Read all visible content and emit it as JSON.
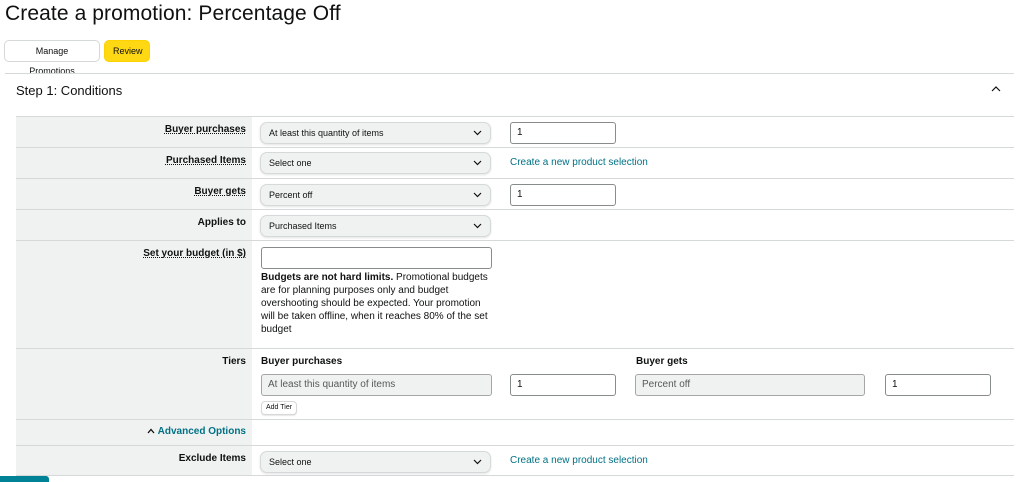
{
  "page": {
    "title": "Create a promotion: Percentage Off",
    "manage_label": "Manage Promotions",
    "review_label": "Review"
  },
  "step1": {
    "title": "Step 1: Conditions",
    "rows": {
      "buyer_purchases": {
        "label": "Buyer purchases",
        "select": "At least this quantity of items",
        "input": "1"
      },
      "purchased_items": {
        "label": "Purchased Items",
        "select": "Select one",
        "link": "Create a new product selection"
      },
      "buyer_gets": {
        "label": "Buyer gets",
        "select": "Percent off",
        "input": "1"
      },
      "applies_to": {
        "label": "Applies to",
        "select": "Purchased Items"
      },
      "budget": {
        "label": "Set your budget (in $)",
        "input": "",
        "note_bold": "Budgets are not hard limits.",
        "note_rest": " Promotional budgets are for planning purposes only and budget overshooting should be expected. Your promotion will be taken offline, when it reaches 80% of the set budget"
      },
      "tiers": {
        "label": "Tiers",
        "buyer_purchases_header": "Buyer purchases",
        "buyer_gets_header": "Buyer gets",
        "purchases_value": "At least this quantity of items",
        "purchases_qty": "1",
        "gets_value": "Percent off",
        "gets_qty": "1",
        "add_tier": "Add Tier"
      },
      "advanced": {
        "label": "Advanced Options"
      },
      "exclude": {
        "label": "Exclude Items",
        "select": "Select one",
        "link": "Create a new product selection"
      }
    }
  },
  "icons": {
    "collapse": "chevron-up-icon",
    "dropdown": "chevron-down-icon"
  },
  "colors": {
    "accent_yellow": "#ffd814",
    "link_teal": "#007185",
    "label_bg": "#f0f2f2",
    "border": "#d5d9d9"
  }
}
